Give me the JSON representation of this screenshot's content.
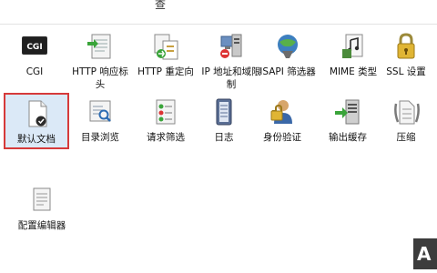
{
  "top_text": "查",
  "features": [
    {
      "label": "CGI",
      "icon": "cgi-icon"
    },
    {
      "label": "HTTP 响应标头",
      "icon": "http-response-headers-icon"
    },
    {
      "label": "HTTP 重定向",
      "icon": "http-redirect-icon"
    },
    {
      "label": "IP 地址和域限制",
      "icon": "ip-domain-restrictions-icon"
    },
    {
      "label": "ISAPI 筛选器",
      "icon": "isapi-filters-icon"
    },
    {
      "label": "MIME 类型",
      "icon": "mime-types-icon"
    },
    {
      "label": "SSL 设置",
      "icon": "ssl-settings-icon"
    },
    {
      "label": "默认文档",
      "icon": "default-document-icon",
      "selected": true
    },
    {
      "label": "目录浏览",
      "icon": "directory-browsing-icon"
    },
    {
      "label": "请求筛选",
      "icon": "request-filtering-icon"
    },
    {
      "label": "日志",
      "icon": "logging-icon"
    },
    {
      "label": "身份验证",
      "icon": "authentication-icon"
    },
    {
      "label": "输出缓存",
      "icon": "output-caching-icon"
    },
    {
      "label": "压缩",
      "icon": "compression-icon"
    }
  ],
  "management": [
    {
      "label": "配置编辑器",
      "icon": "configuration-editor-icon"
    }
  ],
  "watermark": "A",
  "colors": {
    "selection_border": "#d63a3a",
    "selection_fill": "#dbe9f7"
  }
}
